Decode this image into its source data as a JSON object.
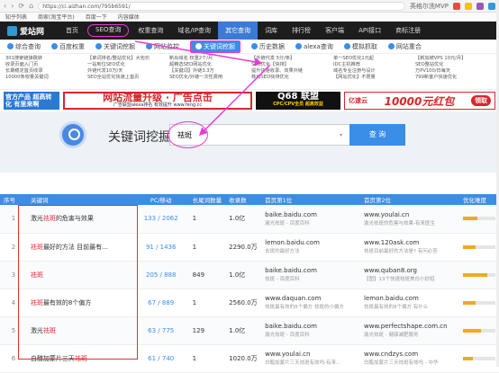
{
  "browser": {
    "url": "https://ci.aizhan.com/795b6591/",
    "search_hint": "英格尔洗MVP",
    "back": "‹",
    "forward": "›",
    "reload": "⟳",
    "home": "⌂"
  },
  "bookmarks": [
    "知乎列表",
    "商家(淘宝平台)",
    "百度一下",
    "内容媒体"
  ],
  "topnav": {
    "logo": "爱站网",
    "items": [
      "首页",
      "SEO查询",
      "权重查询",
      "域名/IP查询",
      "其它查询",
      "词库",
      "排行榜",
      "客户端",
      "API接口",
      "商标注册"
    ]
  },
  "toolrow": [
    "综合查询",
    "百度权重",
    "关键词挖掘",
    "网站监控",
    "关键词挖掘",
    "历史数据",
    "alexa查询",
    "模拟抓取",
    "网站重合"
  ],
  "adcols": [
    [
      "301搜索链接跳转",
      "收录页面入门页",
      "长期稳定首页收录",
      "10000条权量关键词"
    ],
    [
      "【单词排名/整站优化】大包价",
      "一站到位SEO优化",
      "外链代发10万/天",
      "SEO全站优化快速上首页"
    ],
    [
      "新出域名 权重2个/月",
      "超精选SEO网站优化",
      "【关键词】外链3.3万",
      "SEO优化/外链一次性费用"
    ],
    [
      "【外链代发 5分/条】",
      "SEO优化【快排】",
      "提升快速收录、效果外链",
      "移动SEO快排优化"
    ],
    [
      "单一SEO优化1元起",
      "IDC主机推荐",
      "域名专业注册与设计",
      "【网站优化】不限量"
    ],
    [
      "【新加坡VPS 10元/月】",
      "SEO整站优化",
      "万PV100/日每天",
      "799新客户快速优化"
    ]
  ],
  "banners": {
    "b1": "官方产品 超高转化 有里来啊",
    "b2_title": "网站流量升级 · 广告点击",
    "b2_sub": "广告联盟alexa排名 有效提升 www.feng.cc",
    "b3_title": "Q68 联盟",
    "b3_sub": "CPC/CPV全员 超高效益",
    "b4_brand": "亿速云",
    "b4_amount": "10000元红包",
    "b4_button": "领取"
  },
  "search": {
    "title": "关键词挖掘",
    "value": "祛斑",
    "button": "查 询",
    "dropdown": "▾"
  },
  "table": {
    "headers": [
      "序号",
      "关键词",
      "PC/移动",
      "长尾词数量",
      "收录数",
      "首页第1位",
      "首页第2位",
      "优化难度"
    ],
    "rows": [
      {
        "n": "1",
        "pre": "激光",
        "hl": "祛斑",
        "post": "的危害与效果",
        "pc": "133 / 2062",
        "tail": "1",
        "sl": "1.0亿",
        "s1": "baike.baidu.com",
        "s1t": "激光祛斑 - 百度百科",
        "s2": "www.youlai.cn",
        "s2t": "激光祛斑的危害与效果-有来医生",
        "diff": 0.45
      },
      {
        "n": "2",
        "pre": "",
        "hl": "祛斑",
        "post": "最好的方法 目前最有...",
        "pc": "91 / 1436",
        "tail": "1",
        "sl": "2290.0万",
        "s1": "lemon.baidu.com",
        "s1t": "去斑的最好方法",
        "s2": "www.120ask.com",
        "s2t": "祛斑目前最好的方法是? 有问必答",
        "diff": 0.4
      },
      {
        "n": "3",
        "pre": "",
        "hl": "祛斑",
        "post": "",
        "pc": "205 / 888",
        "tail": "849",
        "sl": "1.0亿",
        "s1": "baike.baidu.com",
        "s1t": "祛斑 - 百度百科",
        "s2": "www.quban8.org",
        "s2t": "【图】13个快速祛斑美白小妙招",
        "diff": 0.75
      },
      {
        "n": "4",
        "pre": "",
        "hl": "祛斑",
        "post": "最有效的8个偏方",
        "pc": "67 / 889",
        "tail": "1",
        "sl": "2560.0万",
        "s1": "www.daquan.com",
        "s1t": "祛斑最有效的8个偏方 祛斑的小偏方",
        "s2": "lemon.baidu.com",
        "s2t": "祛斑最有效的8个偏方 有什么",
        "diff": 0.4
      },
      {
        "n": "5",
        "pre": "激光",
        "hl": "祛斑",
        "post": "",
        "pc": "63 / 775",
        "tail": "129",
        "sl": "1.0亿",
        "s1": "baike.baidu.com",
        "s1t": "激光祛斑 - 百度百科",
        "s2": "www.perfectshape.com.cn",
        "s2t": "激光祛斑 - 健康减肥服务",
        "diff": 0.55
      },
      {
        "n": "6",
        "pre": "白醋加蒙片三天",
        "hl": "祛斑",
        "post": "",
        "pc": "61 / 740",
        "tail": "1",
        "sl": "1020.0万",
        "s1": "www.youlai.cn",
        "s1t": "白醋加蒙片三天祛斑有效吗-有来...",
        "s2": "www.cndzys.com",
        "s2t": "白醋加蒙片三天祛斑有效吗 - 中华",
        "diff": 0.3
      }
    ]
  },
  "colors": {
    "nav_bg": "#1d1d1d",
    "accent": "#3a8ee6",
    "highlight": "#d9262c",
    "annotation": "#e53cd8",
    "box": "#e03131"
  }
}
